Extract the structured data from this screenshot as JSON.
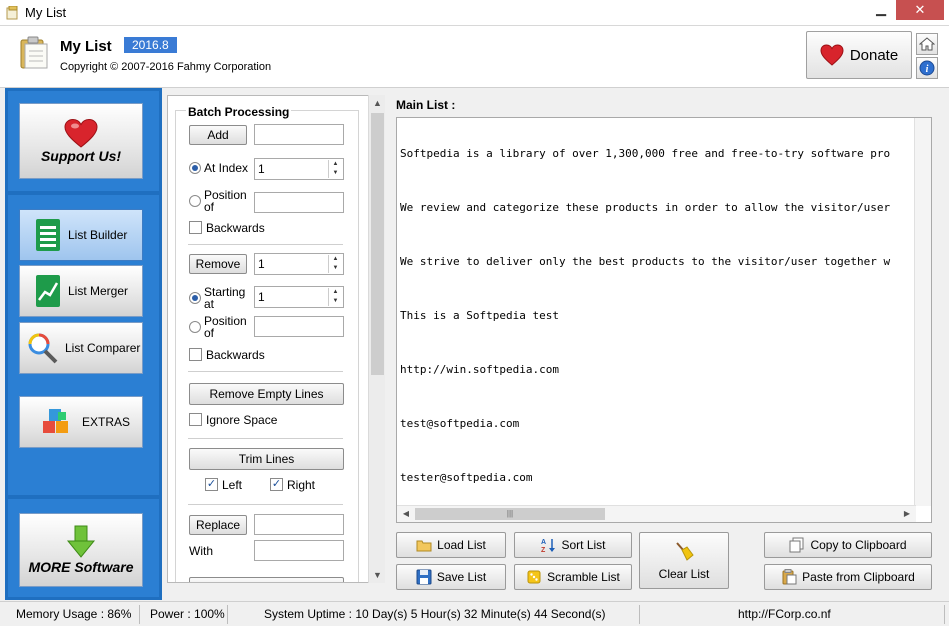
{
  "window": {
    "title": "My List"
  },
  "header": {
    "app_name": "My List",
    "version": "2016.8",
    "copyright": "Copyright © 2007-2016 Fahmy Corporation",
    "donate_label": "Donate"
  },
  "sidebar": {
    "support_label": "Support Us!",
    "items": [
      {
        "label": "List Builder"
      },
      {
        "label": "List Merger"
      },
      {
        "label": "List Comparer"
      },
      {
        "label": "EXTRAS"
      }
    ],
    "more_label": "MORE Software"
  },
  "batch": {
    "title": "Batch Processing",
    "add_label": "Add",
    "add_value": "",
    "at_index_label": "At Index",
    "at_index_value": "1",
    "position_of_label": "Position of",
    "position_of_value": "",
    "backwards_label": "Backwards",
    "remove_label": "Remove",
    "remove_value": "1",
    "starting_at_label": "Starting at",
    "starting_at_value": "1",
    "position_of2_label": "Position of",
    "position_of2_value": "",
    "backwards2_label": "Backwards",
    "remove_empty_label": "Remove Empty Lines",
    "ignore_space_label": "Ignore Space",
    "trim_label": "Trim Lines",
    "left_label": "Left",
    "right_label": "Right",
    "replace_label": "Replace",
    "replace_value": "",
    "with_label": "With",
    "with_value": ""
  },
  "main": {
    "label": "Main List :",
    "lines": [
      "Softpedia is a library of over 1,300,000 free and free-to-try software pro",
      "We review and categorize these products in order to allow the visitor/user",
      "We strive to deliver only the best products to the visitor/user together w",
      "This is a Softpedia test",
      "http://win.softpedia.com",
      "test@softpedia.com",
      "tester@softpedia.com"
    ]
  },
  "actions": {
    "load": "Load List",
    "sort": "Sort List",
    "clear": "Clear List",
    "copy": "Copy to Clipboard",
    "save": "Save List",
    "scramble": "Scramble List",
    "paste": "Paste from Clipboard"
  },
  "status": {
    "memory": "Memory Usage : 86%",
    "power": "Power : 100%",
    "uptime": "System Uptime : 10 Day(s) 5 Hour(s) 32 Minute(s) 44 Second(s)",
    "url": "http://FCorp.co.nf"
  },
  "colors": {
    "sidebar_bg": "#1f6fc0",
    "accent": "#3a7bd5",
    "close_button": "#c75050"
  }
}
